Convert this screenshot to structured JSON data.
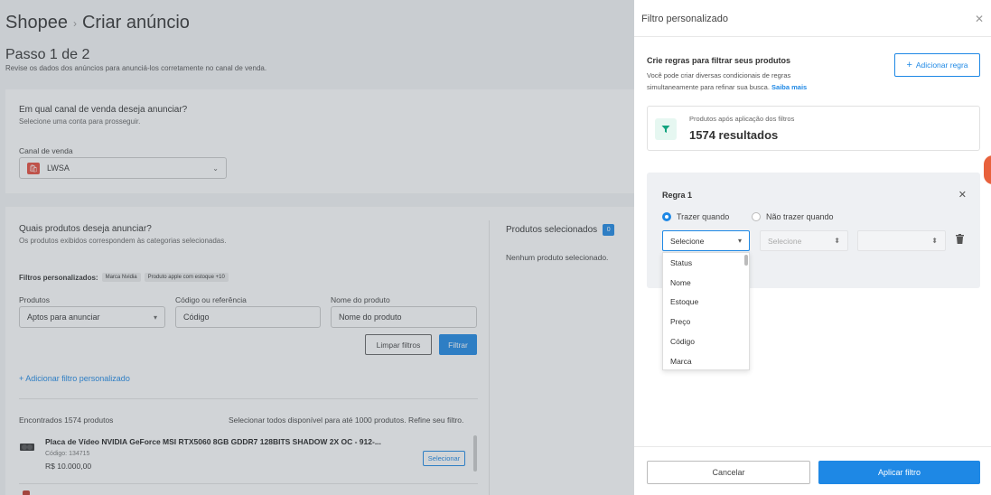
{
  "header": {
    "brand": "Shopee",
    "separator": "›",
    "title": "Criar anúncio"
  },
  "step": {
    "title": "Passo 1 de 2",
    "subtitle": "Revise os dados dos anúncios para anunciá-los corretamente no canal de venda."
  },
  "channel_section": {
    "question": "Em qual canal de venda deseja anunciar?",
    "hint": "Selecione uma conta para prosseguir.",
    "field_label": "Canal de venda",
    "selected_value": "LWSA"
  },
  "products_section": {
    "question": "Quais produtos deseja anunciar?",
    "hint": "Os produtos exibidos correspondem às categorias selecionadas.",
    "custom_filters_label": "Filtros personalizados:",
    "filter_tags": [
      "Marca Nvidia",
      "Produto apple com estoque +10"
    ],
    "fields": {
      "produtos_label": "Produtos",
      "produtos_value": "Aptos para anunciar",
      "codigo_label": "Código ou referência",
      "codigo_placeholder": "Código",
      "nome_label": "Nome do produto",
      "nome_placeholder": "Nome do produto"
    },
    "clear_button": "Limpar filtros",
    "filter_button": "Filtrar",
    "add_filter_link": "+ Adicionar filtro personalizado",
    "found_text": "Encontrados 1574 produtos",
    "select_all_text": "Selecionar todos disponível para até 1000 produtos. Refine seu filtro.",
    "product": {
      "name": "Placa de Vídeo NVIDIA GeForce MSI RTX5060 8GB GDDR7 128BITS SHADOW 2X OC - 912-...",
      "code": "Código: 134715",
      "price": "R$ 10.000,00",
      "select_button": "Selecionar"
    }
  },
  "selected_section": {
    "title": "Produtos selecionados",
    "count": "0",
    "empty_text": "Nenhum produto selecionado."
  },
  "drawer": {
    "title": "Filtro personalizado",
    "rules_title": "Crie regras para filtrar seus produtos",
    "rules_desc": "Você pode criar diversas condicionais de regras simultaneamente para refinar sua busca.",
    "learn_more": "Saiba mais",
    "add_rule_button": "Adicionar regra",
    "results_label": "Produtos após aplicação dos filtros",
    "results_value": "1574 resultados",
    "rule": {
      "title": "Regra 1",
      "option_include": "Trazer quando",
      "option_exclude": "Não trazer quando",
      "field_select": "Selecione",
      "operator_select": "Selecione",
      "value_select": "",
      "dropdown_options": [
        "Status",
        "Nome",
        "Estoque",
        "Preço",
        "Código",
        "Marca"
      ]
    },
    "cancel_button": "Cancelar",
    "apply_button": "Aplicar filtro"
  },
  "colors": {
    "primary": "#1e88e5",
    "page_bg": "#f4f5f7",
    "store_icon": "#e74c3c",
    "funnel_icon": "#12a37f"
  }
}
